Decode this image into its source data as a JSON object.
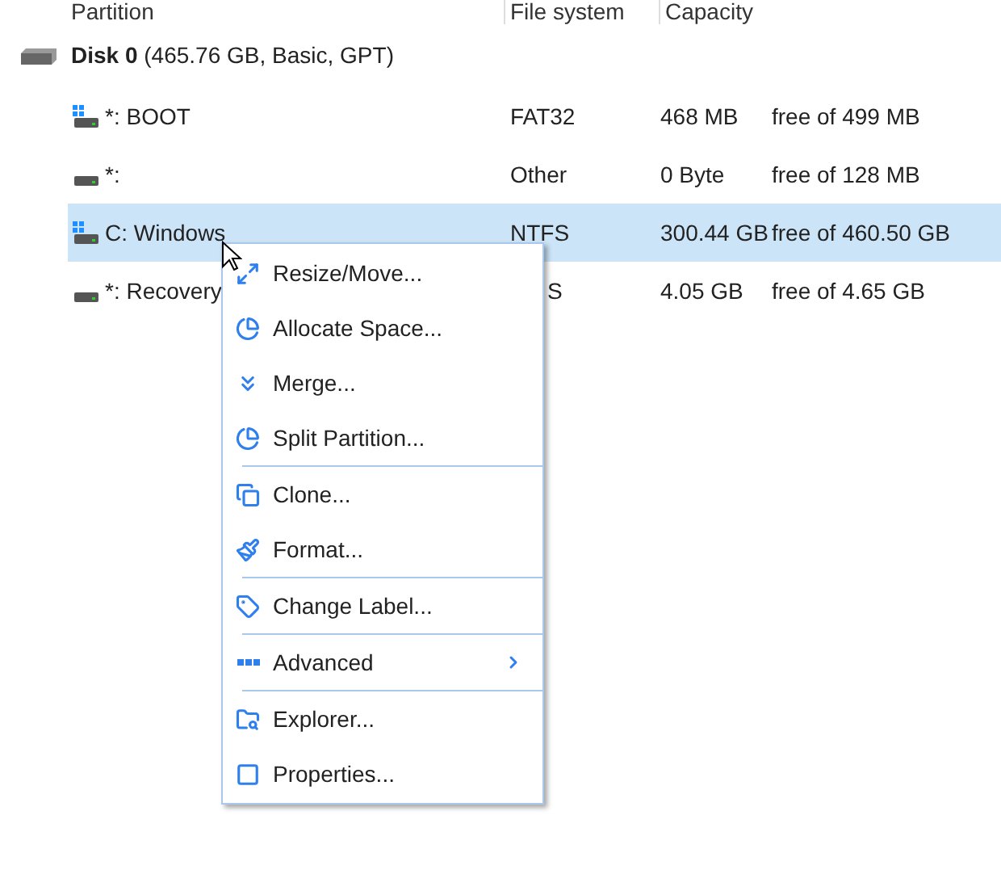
{
  "columns": [
    "Partition",
    "File system",
    "Capacity"
  ],
  "disk": {
    "name": "Disk 0",
    "details": "(465.76 GB, Basic, GPT)"
  },
  "partitions": [
    {
      "name": "*: BOOT",
      "kind": "system",
      "file_system": "FAT32",
      "used": "468 MB",
      "total": "free of 499 MB",
      "selected": false
    },
    {
      "name": "*:",
      "kind": "plain",
      "file_system": "Other",
      "used": "0 Byte",
      "total": "free of 128 MB",
      "selected": false
    },
    {
      "name": "C: Windows",
      "kind": "system",
      "file_system": "NTFS",
      "used": "300.44 GB",
      "total": "free of 460.50 GB",
      "selected": true
    },
    {
      "name": "*: Recovery",
      "kind": "plain",
      "file_system": "S",
      "file_system_covered": true,
      "used": "4.05 GB",
      "total": "free of 4.65 GB",
      "selected": false
    }
  ],
  "context_menu": {
    "groups": [
      [
        {
          "label": "Resize/Move..."
        },
        {
          "label": "Allocate Space..."
        },
        {
          "label": "Merge..."
        },
        {
          "label": "Split Partition..."
        }
      ],
      [
        {
          "label": "Clone..."
        },
        {
          "label": "Format..."
        }
      ],
      [
        {
          "label": "Change Label..."
        }
      ],
      [
        {
          "label": "Advanced",
          "submenu": true
        }
      ],
      [
        {
          "label": "Explorer..."
        },
        {
          "label": "Properties..."
        }
      ]
    ]
  }
}
